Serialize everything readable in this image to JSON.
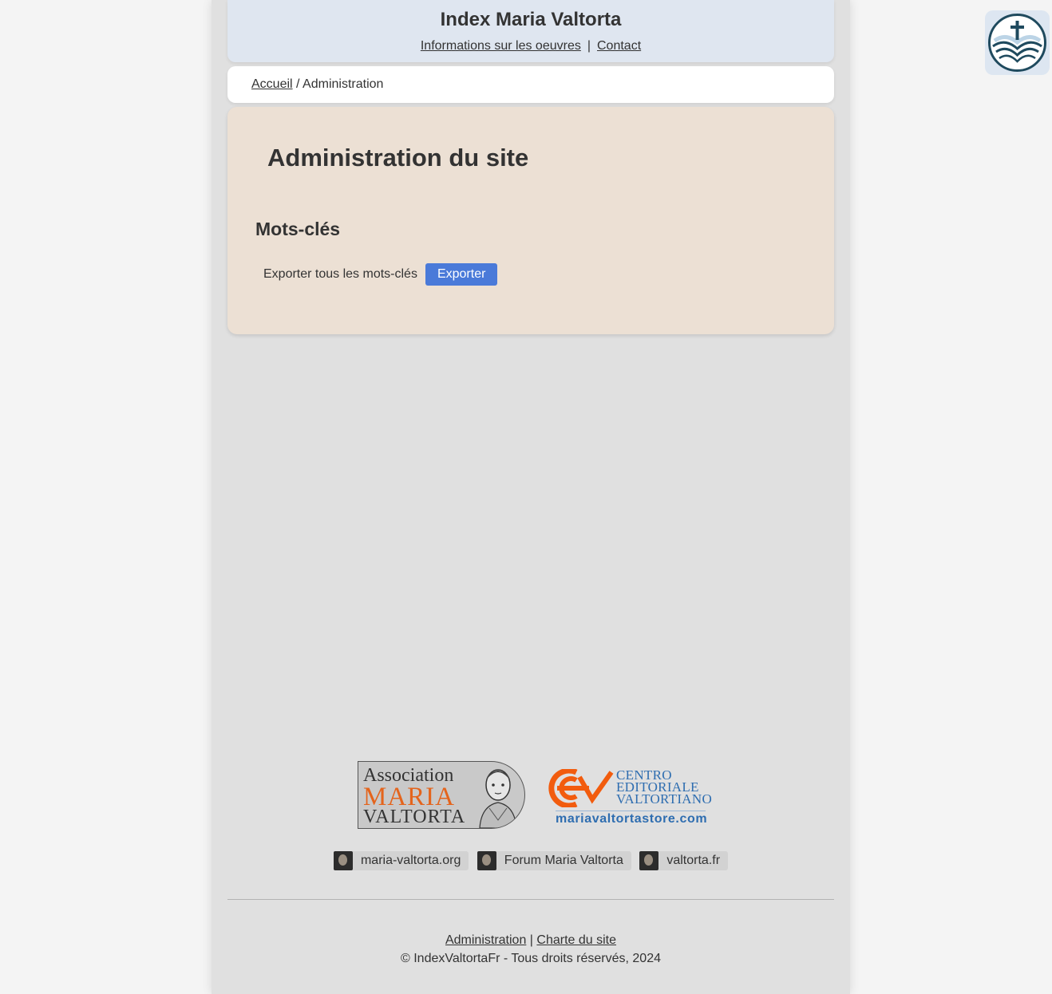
{
  "header": {
    "title": "Index Maria Valtorta",
    "nav": [
      "Informations sur les oeuvres",
      "Contact"
    ],
    "separator": "|"
  },
  "breadcrumb": {
    "home": "Accueil",
    "separator": "/",
    "current": "Administration"
  },
  "main": {
    "title": "Administration du site",
    "section_title": "Mots-clés",
    "export_label": "Exporter tous les mots-clés",
    "export_button": "Exporter"
  },
  "logos": {
    "association": {
      "line1": "Association",
      "line2": "MARIA",
      "line3": "VALTORTA"
    },
    "cev": {
      "line1": "CENTRO",
      "line2": "EDITORIALE",
      "line3": "VALTORTIANO",
      "url": "mariavaltortastore.com"
    }
  },
  "links": [
    "maria-valtorta.org",
    "Forum Maria Valtorta",
    "valtorta.fr"
  ],
  "footer": {
    "admin_link": "Administration",
    "separator": "|",
    "charter_link": "Charte du site",
    "copyright": "© IndexValtortaFr - Tous droits réservés, 2024"
  },
  "colors": {
    "accent_button": "#4a7ad9",
    "header_bg": "#dfe6f0",
    "panel_bg": "#ece0d4",
    "association_orange": "#e4641c",
    "cev_blue": "#2e6db0",
    "cev_orange": "#f25c0e"
  },
  "icons": {
    "app_icon": "cross-book-icon",
    "link_avatar": "portrait-icon"
  }
}
